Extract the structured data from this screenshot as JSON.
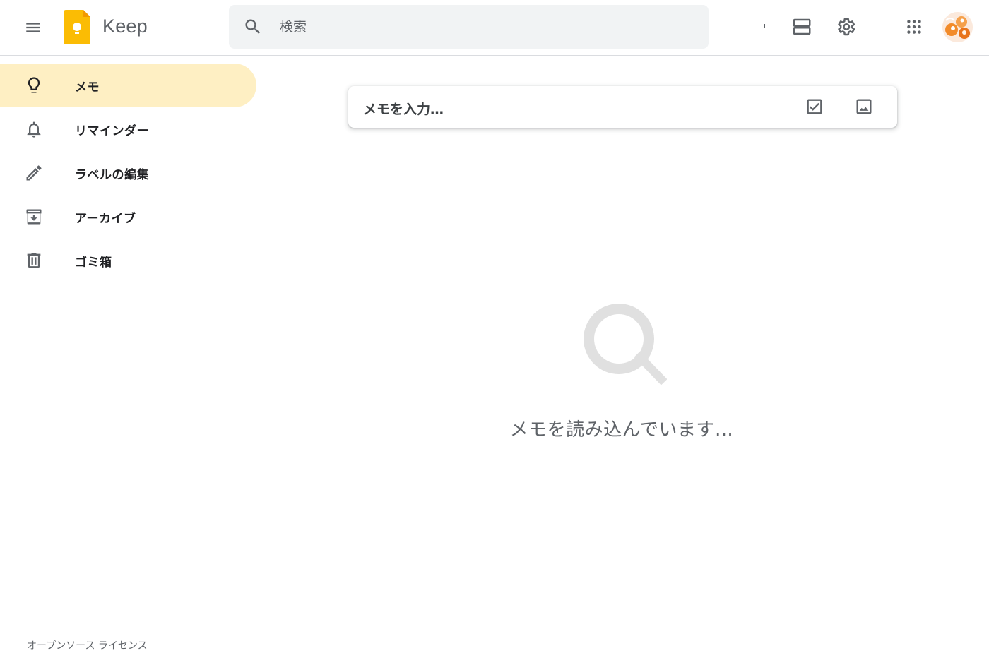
{
  "header": {
    "app_name": "Keep",
    "search_placeholder": "検索",
    "icons": [
      "menu-icon",
      "search-icon",
      "list-view-icon",
      "settings-icon",
      "apps-icon",
      "account-avatar"
    ]
  },
  "sidebar": {
    "items": [
      {
        "label": "メモ",
        "icon": "lightbulb-icon",
        "active": true
      },
      {
        "label": "リマインダー",
        "icon": "bell-icon",
        "active": false
      },
      {
        "label": "ラベルの編集",
        "icon": "pencil-icon",
        "active": false
      },
      {
        "label": "アーカイブ",
        "icon": "archive-icon",
        "active": false
      },
      {
        "label": "ゴミ箱",
        "icon": "trash-icon",
        "active": false
      }
    ],
    "footer_link": "オープンソース ライセンス"
  },
  "note_input": {
    "placeholder": "メモを入力…"
  },
  "main": {
    "loading_text": "メモを読み込んでいます…"
  },
  "colors": {
    "active_nav_bg": "#feefc3",
    "keep_yellow": "#fbbc04",
    "search_bg": "#f1f3f4",
    "icon_gray": "#5f6368"
  }
}
